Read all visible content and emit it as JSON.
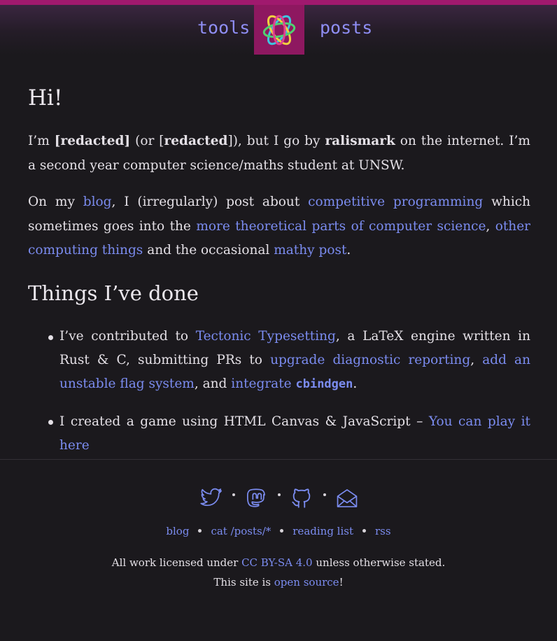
{
  "nav": {
    "tools_label": "tools",
    "posts_label": "posts",
    "logo_icon": "ralisimark-logo-icon"
  },
  "colors": {
    "accent_bar": "#a0196e",
    "logo_bg": "#8e1860",
    "link": "#7b8cf0",
    "background": "#1b191d"
  },
  "intro": {
    "heading": "Hi!",
    "p1": {
      "im": "I’m ",
      "redacted1": "[redacted]",
      "or": " (or [",
      "redacted2": "redacted",
      "close": "]), but I go by ",
      "handle": "ralismark",
      "rest": " on the internet. I’m a second year computer science/maths student at UNSW."
    },
    "p2": {
      "on_my": "On my ",
      "blog_link": "blog",
      "mid1": ", I (irregularly) post about ",
      "cp_link": "competitive programming",
      "mid2": " which sometimes goes into the ",
      "theory_link": "more theoretical parts of computer science",
      "comma": ", ",
      "other_link": "other computing things",
      "mid3": " and the occasional ",
      "math_link": "mathy post",
      "end": "."
    }
  },
  "done": {
    "heading": "Things I’ve done",
    "item1": {
      "pre": "I’ve contributed to ",
      "tectonic_link": "Tectonic Typesetting",
      "mid": ", a LaTeX engine written in Rust & C, submitting PRs to ",
      "diag_link": "upgrade diagnostic reporting",
      "comma": ", ",
      "flag_link": "add an unstable flag system",
      "and": ", and ",
      "integrate_link": "integrate ",
      "code": "cbindgen",
      "end": "."
    },
    "item2": {
      "pre": "I created a game using HTML Canvas & JavaScript – ",
      "play_link": "You can play it here"
    }
  },
  "footer": {
    "icons": [
      "twitter-icon",
      "mastodon-icon",
      "github-icon",
      "email-icon"
    ],
    "links": [
      "blog",
      "cat /posts/*",
      "reading list",
      "rss"
    ],
    "license_pre": "All work licensed under ",
    "license_link": "CC BY-SA 4.0",
    "license_post": " unless otherwise stated.",
    "source_pre": "This site is ",
    "source_link": "open source",
    "source_post": "!"
  }
}
